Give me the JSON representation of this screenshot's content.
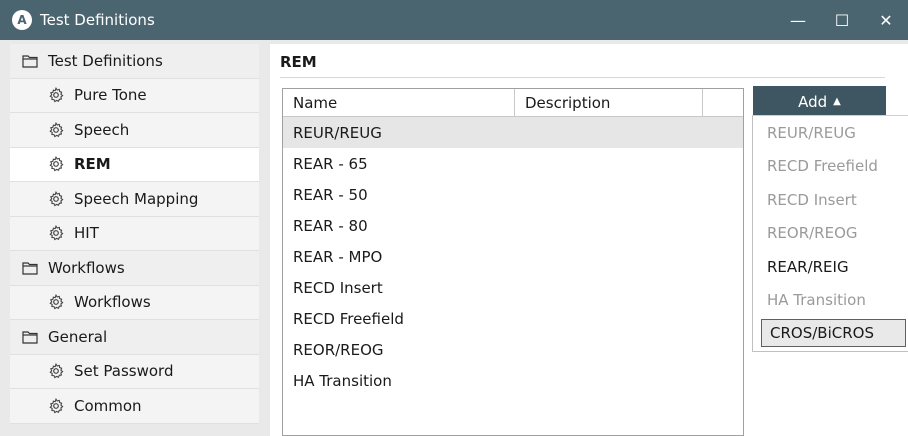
{
  "window": {
    "title": "Test Definitions",
    "app_icon_letter": "A",
    "minimize_glyph": "—",
    "maximize_glyph": "☐",
    "close_glyph": "✕"
  },
  "sidebar": {
    "items": [
      {
        "label": "Test Definitions",
        "icon": "folder-icon",
        "kind": "group"
      },
      {
        "label": "Pure Tone",
        "icon": "gear-icon",
        "kind": "child"
      },
      {
        "label": "Speech",
        "icon": "gear-icon",
        "kind": "child"
      },
      {
        "label": "REM",
        "icon": "gear-icon",
        "kind": "child",
        "active": true
      },
      {
        "label": "Speech Mapping",
        "icon": "gear-icon",
        "kind": "child"
      },
      {
        "label": "HIT",
        "icon": "gear-icon",
        "kind": "child"
      },
      {
        "label": "Workflows",
        "icon": "folder-icon",
        "kind": "group"
      },
      {
        "label": "Workflows",
        "icon": "gear-icon",
        "kind": "child"
      },
      {
        "label": "General",
        "icon": "folder-icon",
        "kind": "group"
      },
      {
        "label": "Set Password",
        "icon": "gear-icon",
        "kind": "child"
      },
      {
        "label": "Common",
        "icon": "gear-icon",
        "kind": "child"
      }
    ]
  },
  "main": {
    "title": "REM",
    "columns": {
      "name": "Name",
      "description": "Description",
      "extra": ""
    },
    "rows": [
      {
        "name": "REUR/REUG",
        "selected": true
      },
      {
        "name": "REAR - 65"
      },
      {
        "name": "REAR - 50"
      },
      {
        "name": "REAR - 80"
      },
      {
        "name": "REAR - MPO"
      },
      {
        "name": "RECD Insert"
      },
      {
        "name": "RECD Freefield"
      },
      {
        "name": "REOR/REOG"
      },
      {
        "name": "HA Transition"
      }
    ],
    "add_button": {
      "label": "Add",
      "arrow": "▲"
    }
  },
  "add_menu": {
    "items": [
      {
        "label": "REUR/REUG",
        "enabled": false
      },
      {
        "label": "RECD Freefield",
        "enabled": false
      },
      {
        "label": "RECD Insert",
        "enabled": false
      },
      {
        "label": "REOR/REOG",
        "enabled": false
      },
      {
        "label": "REAR/REIG",
        "enabled": true
      },
      {
        "label": "HA Transition",
        "enabled": false
      },
      {
        "label": "CROS/BiCROS",
        "enabled": true,
        "focused": true
      }
    ]
  },
  "colors": {
    "titlebar": "#4a6470",
    "add_button": "#3e5661",
    "disabled_text": "#9a9a9a"
  }
}
